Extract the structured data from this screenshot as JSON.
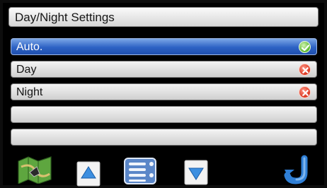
{
  "title": "Day/Night Settings",
  "options": [
    {
      "label": "Auto.",
      "selected": true,
      "status": "enabled",
      "icon": "check-icon"
    },
    {
      "label": "Day",
      "selected": false,
      "status": "disabled",
      "icon": "cross-icon"
    },
    {
      "label": "Night",
      "selected": false,
      "status": "disabled",
      "icon": "cross-icon"
    },
    {
      "label": "",
      "selected": false,
      "status": "empty"
    },
    {
      "label": "",
      "selected": false,
      "status": "empty"
    }
  ],
  "toolbar": [
    {
      "icon": "map-icon"
    },
    {
      "icon": "scroll-up-icon"
    },
    {
      "icon": "menu-list-icon"
    },
    {
      "icon": "scroll-down-icon"
    },
    {
      "icon": "back-icon"
    }
  ],
  "colors": {
    "selected_row": "#2d62c4",
    "enabled_status": "#59b72f",
    "disabled_status": "#d8321b"
  }
}
